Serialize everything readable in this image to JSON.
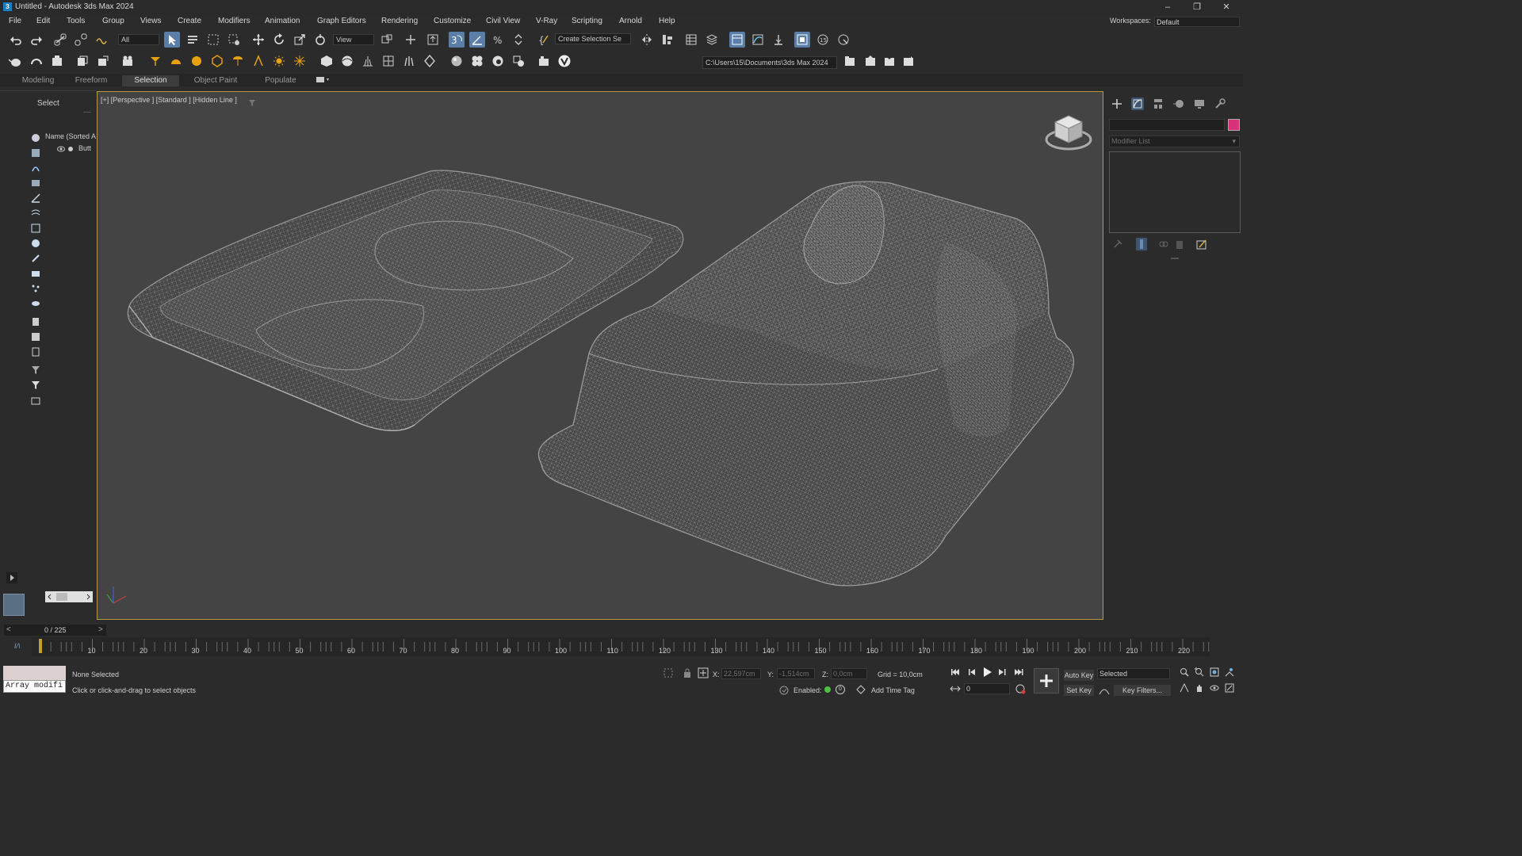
{
  "window": {
    "title": "Untitled - Autodesk 3ds Max 2024",
    "app_icon": "3",
    "controls": [
      "minimize-icon",
      "restore-icon",
      "close-icon"
    ]
  },
  "menu": [
    "File",
    "Edit",
    "Tools",
    "Group",
    "Views",
    "Create",
    "Modifiers",
    "Animation",
    "Graph Editors",
    "Rendering",
    "Customize",
    "Civil View",
    "V-Ray",
    "Scripting",
    "Arnold",
    "Help"
  ],
  "workspace": {
    "label": "Workspaces:",
    "value": "Default"
  },
  "toolbar": {
    "filter_value": "All",
    "refcoord_value": "View",
    "named_selection": "Create Selection Se",
    "project_path": "C:\\Users\\15\\Documents\\3ds Max 2024"
  },
  "ribbon_tabs": [
    "Modeling",
    "Freeform",
    "Selection",
    "Object Paint",
    "Populate"
  ],
  "scene_explorer": {
    "title": "Select",
    "column_header": "Name (Sorted A",
    "items": [
      "Butt"
    ]
  },
  "viewport": {
    "label": "[+] [Perspective ] [Standard ] [Hidden Line ]",
    "axis": {
      "x": "x",
      "y": "y",
      "z": "z"
    }
  },
  "command_panel": {
    "modifier_list": "Modifier List",
    "object_color": "#d8327a"
  },
  "timeline": {
    "frame_display": "0 / 225",
    "ticks": [
      "10",
      "20",
      "30",
      "40",
      "50",
      "60",
      "70",
      "80",
      "90",
      "100",
      "110",
      "120",
      "130",
      "140",
      "150",
      "160",
      "170",
      "180",
      "190",
      "200",
      "210",
      "220"
    ]
  },
  "status": {
    "maxscript_listener": "Array modifi",
    "selection": "None Selected",
    "prompt": "Click or click-and-drag to select objects",
    "x_label": "X:",
    "x_value": "22,597cm",
    "y_label": "Y:",
    "y_value": "-1,514cm",
    "z_label": "Z:",
    "z_value": "0,0cm",
    "grid": "Grid = 10,0cm",
    "enabled_label": "Enabled:",
    "add_time_tag": "Add Time Tag",
    "auto_key": "Auto Key",
    "set_key": "Set Key",
    "selected": "Selected",
    "key_filters": "Key Filters...",
    "frame": "0"
  },
  "colors": {
    "accent": "#5a7ea8",
    "viewport_border": "#b89a3c",
    "wire": "#a8a8a8"
  }
}
